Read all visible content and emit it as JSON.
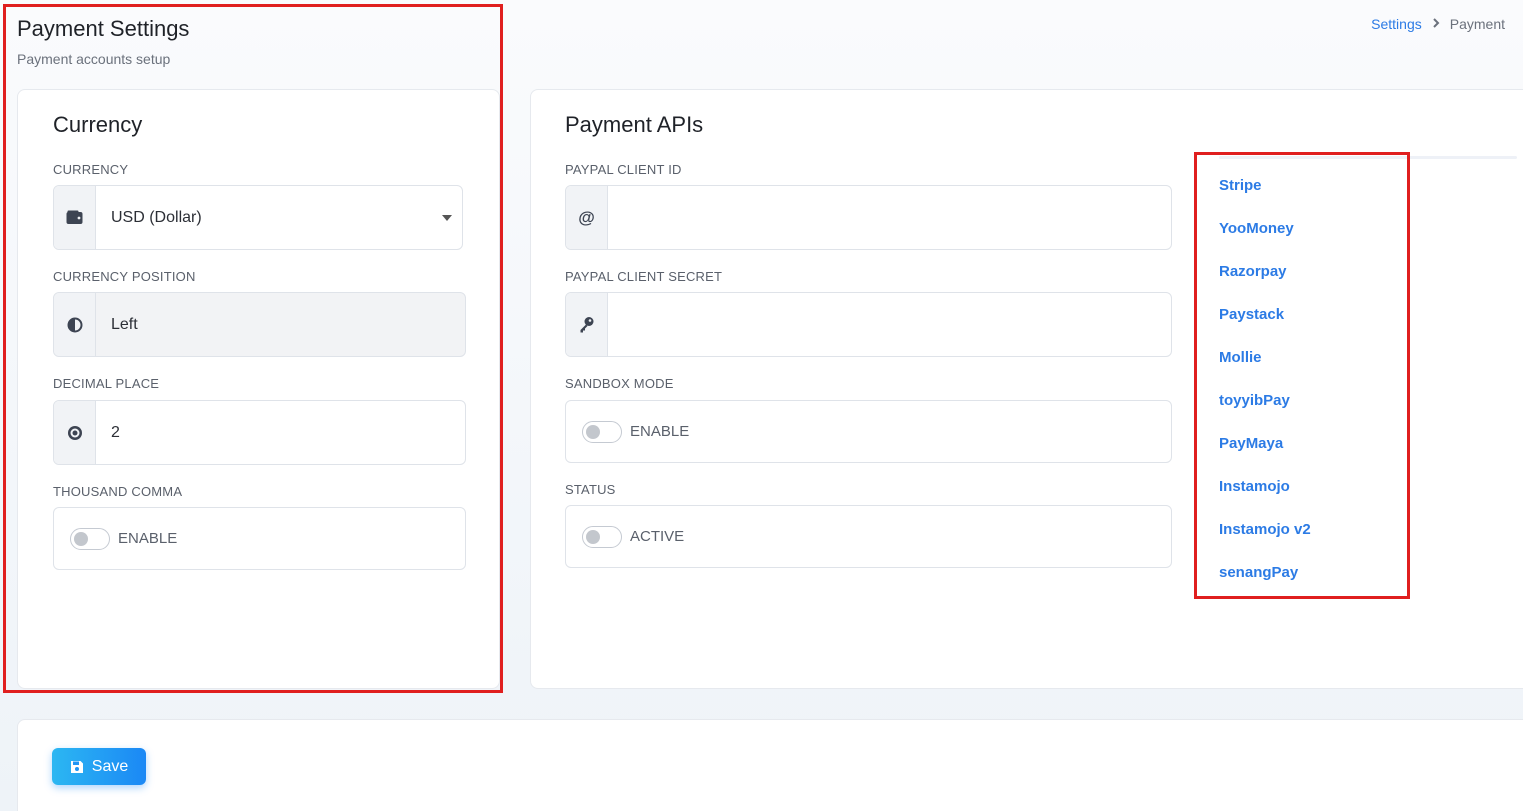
{
  "header": {
    "title": "Payment Settings",
    "subtitle": "Payment accounts setup",
    "breadcrumb": {
      "parent": "Settings",
      "current": "Payment"
    }
  },
  "currency_card": {
    "title": "Currency",
    "currency": {
      "label": "CURRENCY",
      "value": "USD (Dollar)",
      "icon": "wallet-icon"
    },
    "position": {
      "label": "CURRENCY POSITION",
      "value": "Left",
      "icon": "half-circle-icon"
    },
    "decimal": {
      "label": "DECIMAL PLACE",
      "value": "2",
      "icon": "dot-circle-icon"
    },
    "thousand_comma": {
      "label": "THOUSAND COMMA",
      "toggle_text": "ENABLE"
    }
  },
  "api_card": {
    "title": "Payment APIs",
    "client_id": {
      "label": "PAYPAL CLIENT ID",
      "value": "",
      "icon": "at-icon"
    },
    "client_secret": {
      "label": "PAYPAL CLIENT SECRET",
      "value": "",
      "icon": "key-icon"
    },
    "sandbox": {
      "label": "SANDBOX MODE",
      "toggle_text": "ENABLE"
    },
    "status": {
      "label": "STATUS",
      "toggle_text": "ACTIVE"
    },
    "gateways": [
      "Stripe",
      "YooMoney",
      "Razorpay",
      "Paystack",
      "Mollie",
      "toyyibPay",
      "PayMaya",
      "Instamojo",
      "Instamojo v2",
      "senangPay"
    ]
  },
  "footer": {
    "save_label": "Save"
  },
  "colors": {
    "accent": "#2c7be5",
    "highlight": "#e01f1f",
    "button_start": "#2cb7f2",
    "button_end": "#1b88f5"
  }
}
